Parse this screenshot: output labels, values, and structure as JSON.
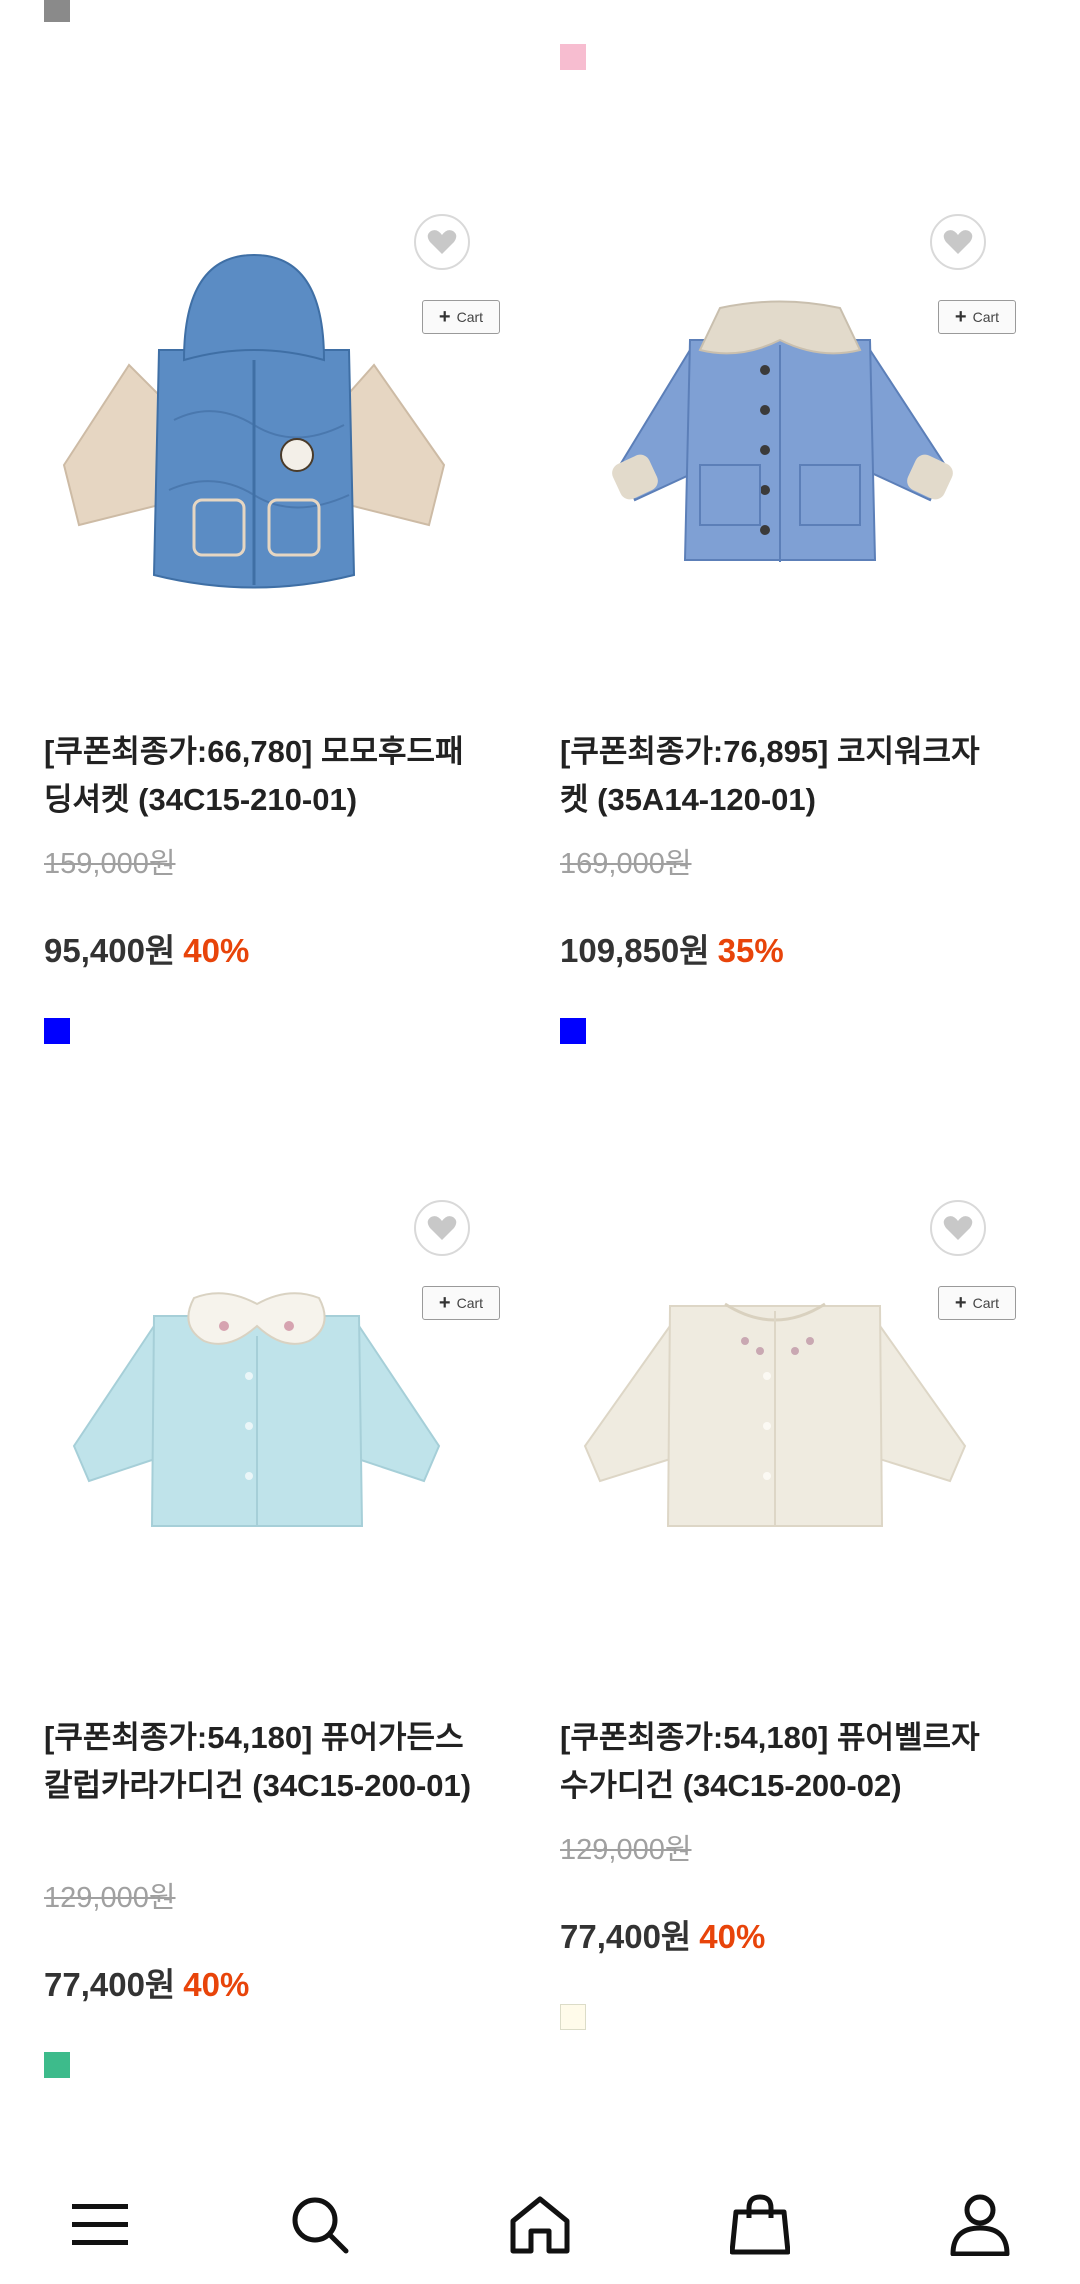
{
  "top_swatches": [
    {
      "color": "#8a8a8a"
    },
    {
      "color": "#f7bdd0"
    }
  ],
  "cart_label": "Cart",
  "products": [
    {
      "title": "[쿠폰최종가:66,780] 모모후드패딩셔켓 (34C15-210-01)",
      "original_price": "159,000원",
      "sale_price": "95,400원",
      "discount": "40%",
      "swatch_color": "#0000ff",
      "image": "blue hooded quilted jacket with beige sleeves"
    },
    {
      "title": "[쿠폰최종가:76,895] 코지워크자켓 (35A14-120-01)",
      "original_price": "169,000원",
      "sale_price": "109,850원",
      "discount": "35%",
      "swatch_color": "#0000ff",
      "image": "light blue collared work jacket"
    },
    {
      "title": "[쿠폰최종가:54,180] 퓨어가든스칼럽카라가디건 (34C15-200-01)",
      "original_price": "129,000원",
      "sale_price": "77,400원",
      "discount": "40%",
      "swatch_color": "#3dbb8b",
      "image": "mint fleece cardigan with scalloped collar"
    },
    {
      "title": "[쿠폰최종가:54,180] 퓨어벨르자수가디건 (34C15-200-02)",
      "original_price": "129,000원",
      "sale_price": "77,400원",
      "discount": "40%",
      "swatch_color": "#fffbea",
      "image": "ivory fleece cardigan with embroidery"
    }
  ],
  "bottom_nav": [
    {
      "name": "menu-icon"
    },
    {
      "name": "search-icon"
    },
    {
      "name": "home-icon"
    },
    {
      "name": "shopping-bag-icon"
    },
    {
      "name": "user-icon"
    }
  ]
}
